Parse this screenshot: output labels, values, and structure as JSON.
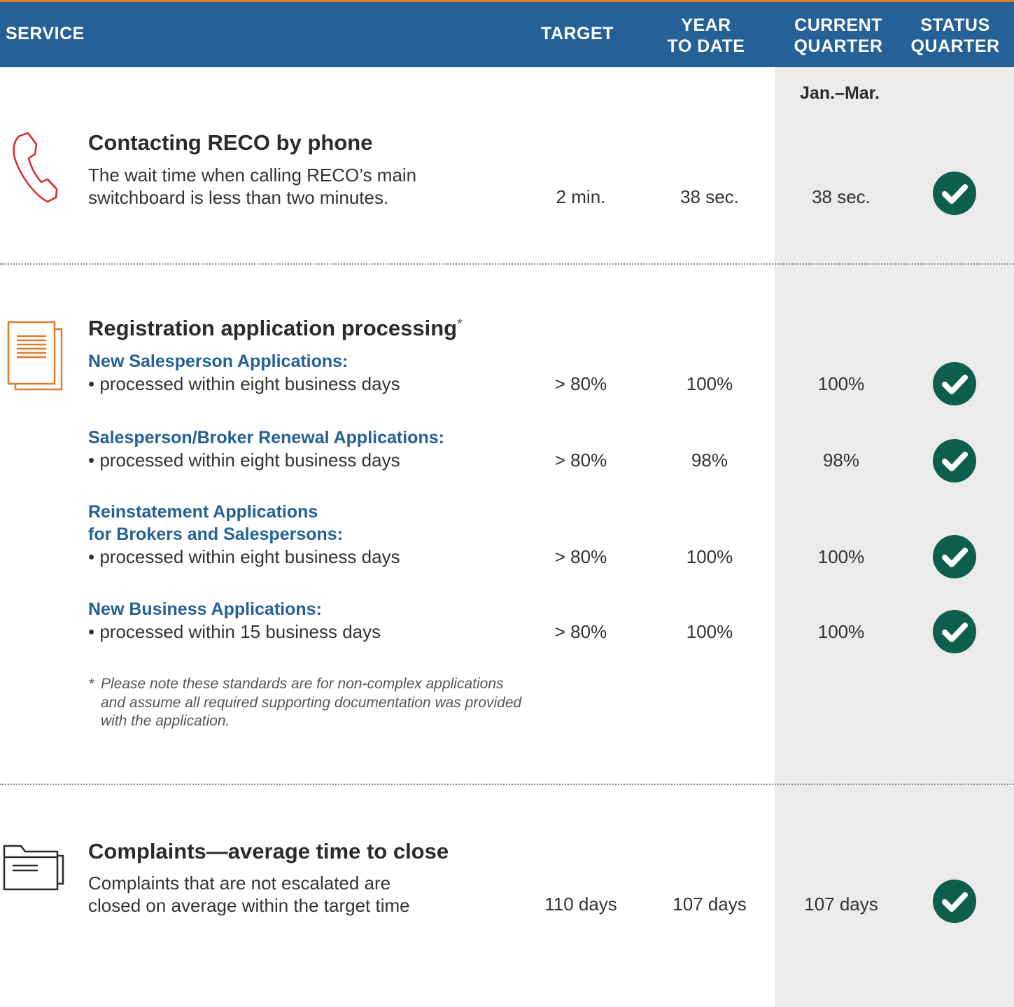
{
  "header": {
    "service": "SERVICE",
    "target": "TARGET",
    "ytd": "YEAR\nTO DATE",
    "current": "CURRENT\nQUARTER",
    "status": "STATUS\nQUARTER"
  },
  "period": "Jan.–Mar.",
  "colors": {
    "header_bg": "#256096",
    "accent_orange": "#e07b2a",
    "check_green": "#0d5e4b",
    "phone_red": "#d62b2b"
  },
  "phone": {
    "icon": "phone-icon",
    "title": "Contacting RECO by phone",
    "desc_line1": "The wait time when calling RECO’s main",
    "desc_line2": "switchboard is less than two minutes.",
    "target": "2 min.",
    "ytd": "38 sec.",
    "current": "38 sec.",
    "status": "met"
  },
  "registration": {
    "icon": "document-icon",
    "title": "Registration application processing",
    "title_mark": "*",
    "rows": [
      {
        "heading": "New Salesperson Applications:",
        "bullet": "•  processed within eight business days",
        "target": "> 80%",
        "ytd": "100%",
        "current": "100%",
        "status": "met"
      },
      {
        "heading": "Salesperson/Broker Renewal Applications:",
        "bullet": "•  processed within eight business days",
        "target": "> 80%",
        "ytd": "98%",
        "current": "98%",
        "status": "met"
      },
      {
        "heading_line1": "Reinstatement Applications",
        "heading_line2": "for Brokers and Salespersons:",
        "bullet": "•  processed within eight business days",
        "target": "> 80%",
        "ytd": "100%",
        "current": "100%",
        "status": "met"
      },
      {
        "heading": "New Business Applications:",
        "bullet": "•  processed within 15 business days",
        "target": "> 80%",
        "ytd": "100%",
        "current": "100%",
        "status": "met"
      }
    ],
    "note_mark": "*",
    "note_line1": "Please note these standards are for non-complex applications",
    "note_line2": "and assume all required supporting documentation was provided",
    "note_line3": "with the application."
  },
  "complaints": {
    "icon": "folder-icon",
    "title": "Complaints—average time to close",
    "desc_line1": "Complaints that are not escalated are",
    "desc_line2": "closed on average within the target time",
    "target": "110 days",
    "ytd": "107 days",
    "current": "107 days",
    "status": "met"
  }
}
